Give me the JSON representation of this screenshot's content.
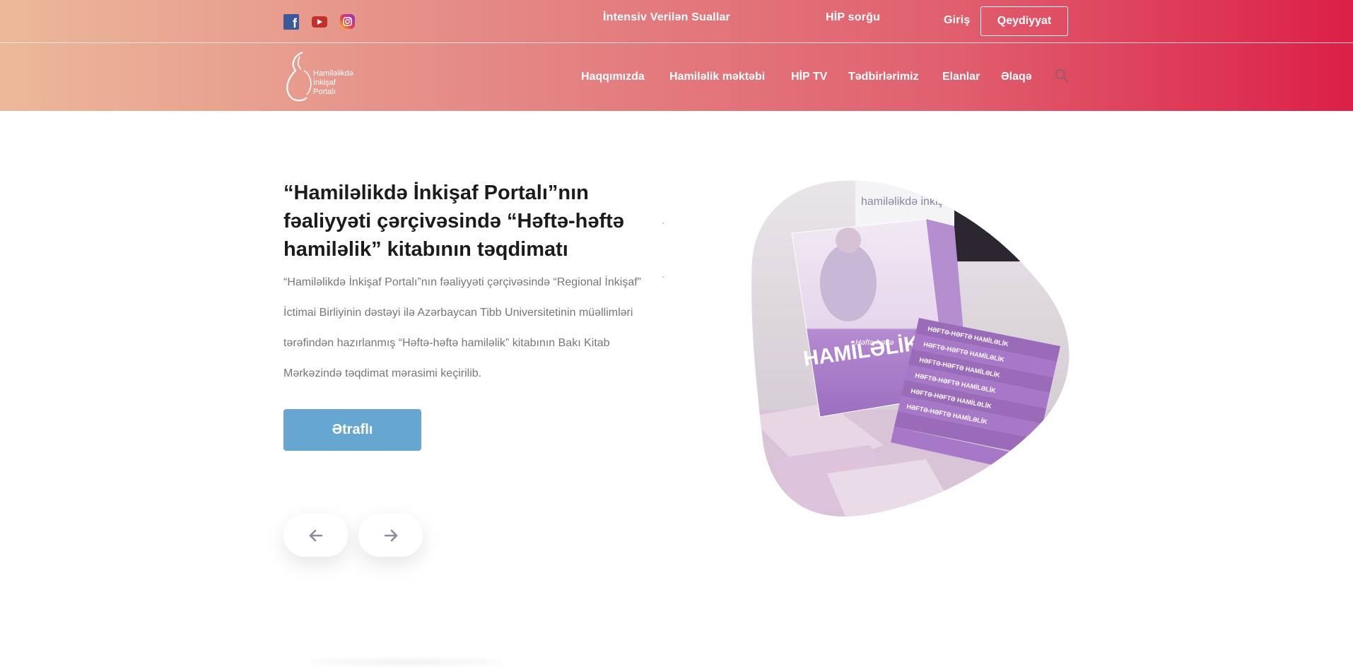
{
  "social": {
    "facebook_glyph": "f",
    "icons": [
      "facebook-icon",
      "youtube-icon",
      "instagram-icon"
    ]
  },
  "topbar": {
    "faq_label": "İntensiv Verilən Suallar",
    "hip_label": "HİP sorğu",
    "login_label": "Giriş",
    "register_label": "Qeydiyyat"
  },
  "logo": {
    "lines": [
      "Hamiləlikdə",
      "İnkişaf",
      "Portalı"
    ]
  },
  "nav": {
    "items": [
      {
        "label": "Haqqımızda"
      },
      {
        "label": "Hamiləlik məktəbi"
      },
      {
        "label": "HİP TV"
      },
      {
        "label": "Tədbirlərimiz"
      },
      {
        "label": "Elanlar"
      },
      {
        "label": "Əlaqə"
      }
    ],
    "search_icon": "search-icon"
  },
  "slide": {
    "title": "“Hamiləlikdə İnkişaf Portalı”nın fəaliyyəti çərçivəsində “Həftə-həftə hamiləlik” kitabının təqdimatı",
    "description": "“Hamiləlikdə İnkişaf Portalı”nın fəaliyyəti çərçivəsində “Regional İnkişaf” İctimai Birliyinin dəstəyi ilə Azərbaycan Tibb Universitetinin müəllimləri tərəfindən hazırlanmış “Həftə-həftə hamiləlik” kitabının Bakı Kitab Mərkəzində təqdimat mərasimi keçirilib.",
    "more_label": "Ətraflı",
    "book_title_small": "Həftə-həftə",
    "book_title": "HAMİLƏLİK",
    "book_spine": "HƏFTƏ-HƏFTƏ HAMİLƏLİK",
    "banner_text": "hamiləlikdə inkişaf"
  },
  "slider": {
    "prev_icon": "arrow-left-icon",
    "next_icon": "arrow-right-icon"
  },
  "colors": {
    "header_start": "#ecb89a",
    "header_end": "#dc1f47",
    "button_blue": "#65a7d1",
    "book_purple": "#a878c8"
  }
}
